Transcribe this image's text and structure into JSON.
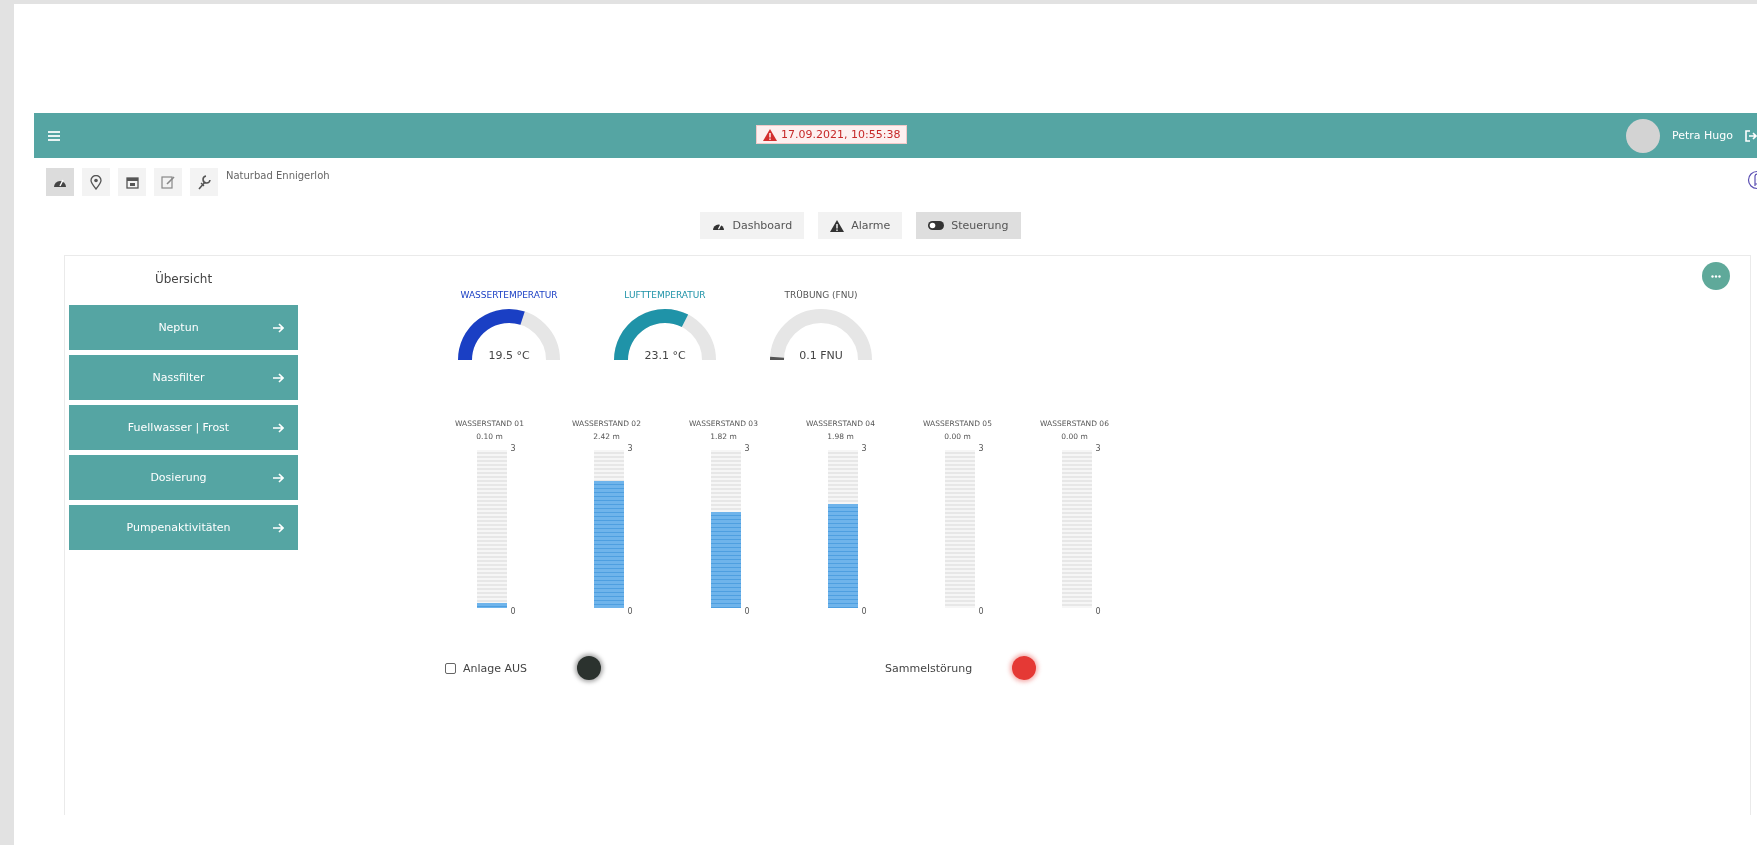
{
  "header": {
    "alarm_time": "17.09.2021, 10:55:38",
    "user": "Petra Hugo"
  },
  "toolbar": {
    "buttons": [
      {
        "kind": "gauge",
        "selected": true
      },
      {
        "kind": "pin",
        "selected": false
      },
      {
        "kind": "calendar",
        "selected": false
      },
      {
        "kind": "edit",
        "selected": false
      },
      {
        "kind": "wrench",
        "selected": false
      }
    ],
    "site": "Naturbad Ennigerloh"
  },
  "tabs": [
    {
      "label": "Dashboard",
      "kind": "gauge",
      "selected": false
    },
    {
      "label": "Alarme",
      "kind": "warning",
      "selected": false
    },
    {
      "label": "Steuerung",
      "kind": "toggle",
      "selected": true
    }
  ],
  "sidebar": {
    "title": "Übersicht",
    "items": [
      {
        "label": "Neptun"
      },
      {
        "label": "Nassfilter"
      },
      {
        "label": "Fuellwasser | Frost"
      },
      {
        "label": "Dosierung"
      },
      {
        "label": "Pumpenaktivitäten"
      }
    ]
  },
  "gauges": [
    {
      "label": "WASSERTEMPERATUR",
      "reading": "19.5 °C",
      "color": "#1a3fc4"
    },
    {
      "label": "LUFTTEMPERATUR",
      "reading": "23.1 °C",
      "color": "#1f93a8"
    },
    {
      "label": "TRÜBUNG (FNU)",
      "reading": "0.1 FNU",
      "color": "#555555"
    }
  ],
  "tanks": [
    {
      "label": "WASSERSTAND 01",
      "reading": "0.10 m",
      "max": "3",
      "min": "0",
      "level": 0.033
    },
    {
      "label": "WASSERSTAND 02",
      "reading": "2.42 m",
      "max": "3",
      "min": "0",
      "level": 0.807
    },
    {
      "label": "WASSERSTAND 03",
      "reading": "1.82 m",
      "max": "3",
      "min": "0",
      "level": 0.607
    },
    {
      "label": "WASSERSTAND 04",
      "reading": "1.98 m",
      "max": "3",
      "min": "0",
      "level": 0.66
    },
    {
      "label": "WASSERSTAND 05",
      "reading": "0.00 m",
      "max": "3",
      "min": "0"
    },
    {
      "label": "WASSERSTAND 06",
      "reading": "0.00 m",
      "max": "3",
      "min": "0"
    }
  ],
  "status": [
    {
      "kind": "checkbox",
      "label": "Anlage AUS",
      "checked": false,
      "on": false
    },
    {
      "kind": "lamp",
      "label": "Sammelstörung",
      "on": true
    }
  ]
}
